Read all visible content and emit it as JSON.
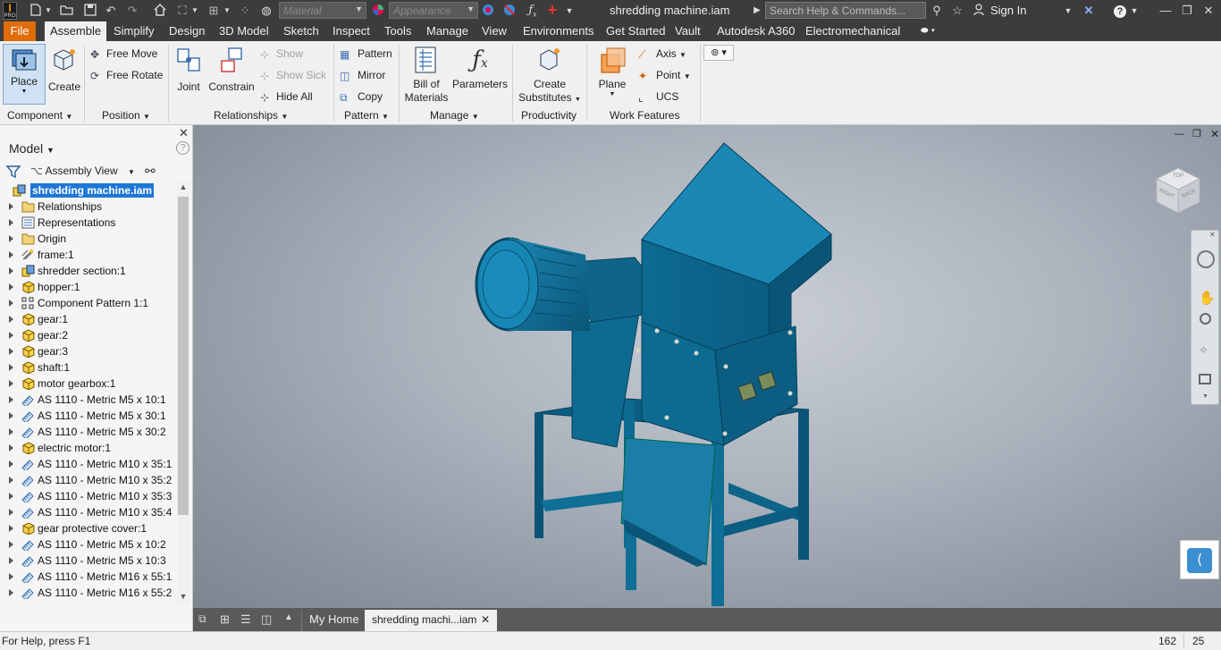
{
  "titlebar": {
    "material_placeholder": "Material",
    "appearance_placeholder": "Appearance",
    "document_title": "shredding machine.iam",
    "search_placeholder": "Search Help & Commands...",
    "sign_in": "Sign In"
  },
  "menu": [
    "File",
    "Assemble",
    "Simplify",
    "Design",
    "3D Model",
    "Sketch",
    "Inspect",
    "Tools",
    "Manage",
    "View",
    "Environments",
    "Get Started",
    "Vault",
    "Autodesk A360",
    "Electromechanical"
  ],
  "ribbon": {
    "place": "Place",
    "create": "Create",
    "free_move": "Free Move",
    "free_rotate": "Free Rotate",
    "joint": "Joint",
    "constrain": "Constrain",
    "show": "Show",
    "show_sick": "Show Sick",
    "hide_all": "Hide All",
    "pattern": "Pattern",
    "mirror": "Mirror",
    "copy": "Copy",
    "bill_of_materials_1": "Bill of",
    "bill_of_materials_2": "Materials",
    "parameters": "Parameters",
    "create_substitutes_1": "Create",
    "create_substitutes_2": "Substitutes",
    "plane": "Plane",
    "axis": "Axis",
    "point": "Point",
    "ucs": "UCS",
    "groups": {
      "component": "Component",
      "position": "Position",
      "relationships": "Relationships",
      "pattern": "Pattern",
      "manage": "Manage",
      "productivity": "Productivity",
      "work_features": "Work Features"
    }
  },
  "browser": {
    "title": "Model",
    "view": "Assembly View",
    "root": "shredding machine.iam",
    "items": [
      {
        "label": "Relationships",
        "icon": "folder"
      },
      {
        "label": "Representations",
        "icon": "representations"
      },
      {
        "label": "Origin",
        "icon": "folder"
      },
      {
        "label": "frame:1",
        "icon": "frame"
      },
      {
        "label": "shredder section:1",
        "icon": "subassembly"
      },
      {
        "label": "hopper:1",
        "icon": "part"
      },
      {
        "label": "Component Pattern 1:1",
        "icon": "pattern"
      },
      {
        "label": "gear:1",
        "icon": "part"
      },
      {
        "label": "gear:2",
        "icon": "part"
      },
      {
        "label": "gear:3",
        "icon": "part"
      },
      {
        "label": "shaft:1",
        "icon": "part"
      },
      {
        "label": "motor gearbox:1",
        "icon": "part"
      },
      {
        "label": "AS 1110 - Metric M5 x 10:1",
        "icon": "fastener"
      },
      {
        "label": "AS 1110 - Metric M5 x 30:1",
        "icon": "fastener"
      },
      {
        "label": "AS 1110 - Metric M5 x 30:2",
        "icon": "fastener"
      },
      {
        "label": "electric motor:1",
        "icon": "part"
      },
      {
        "label": "AS 1110 - Metric M10 x 35:1",
        "icon": "fastener"
      },
      {
        "label": "AS 1110 - Metric M10 x 35:2",
        "icon": "fastener"
      },
      {
        "label": "AS 1110 - Metric M10 x 35:3",
        "icon": "fastener"
      },
      {
        "label": "AS 1110 - Metric M10 x 35:4",
        "icon": "fastener"
      },
      {
        "label": "gear protective cover:1",
        "icon": "part"
      },
      {
        "label": "AS 1110 - Metric M5 x 10:2",
        "icon": "fastener"
      },
      {
        "label": "AS 1110 - Metric M5 x 10:3",
        "icon": "fastener"
      },
      {
        "label": "AS 1110 - Metric M16 x 55:1",
        "icon": "fastener"
      },
      {
        "label": "AS 1110 - Metric M16 x 55:2",
        "icon": "fastener"
      }
    ]
  },
  "viewcube": {
    "top": "TOP",
    "right": "RIGHT",
    "back": "BACK"
  },
  "tabs": {
    "home": "My Home",
    "doc": "shredding machi...iam"
  },
  "status": {
    "help": "For Help, press F1",
    "a": "162",
    "b": "25"
  },
  "colors": {
    "accent": "#e06c0a",
    "model": "#0f6f96",
    "dark_chrome": "#3c3c3c",
    "selection": "#1e76d6"
  }
}
